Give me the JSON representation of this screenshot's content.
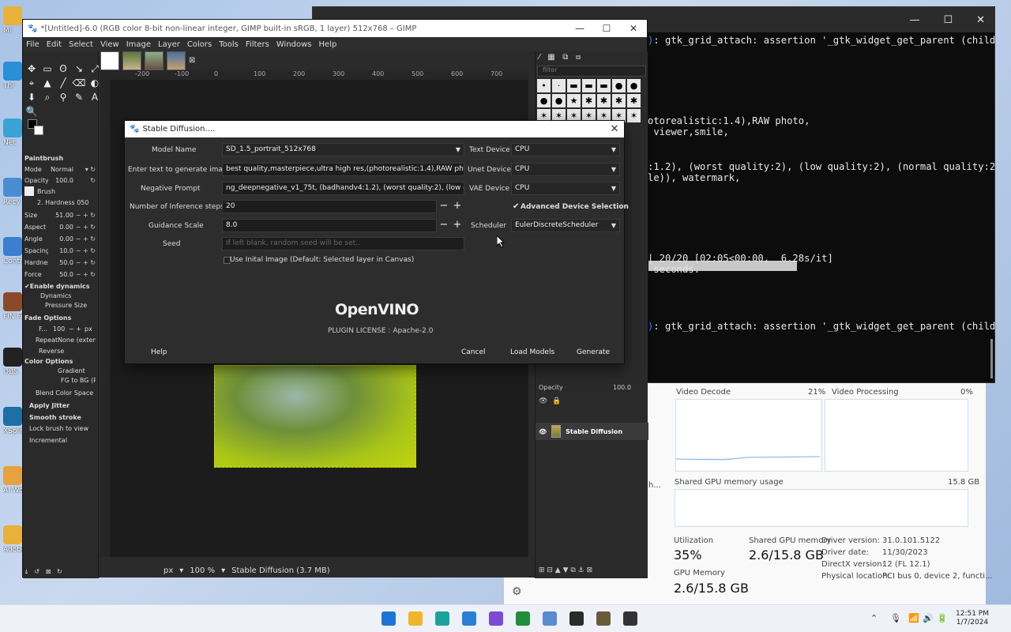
{
  "desktop": {
    "icons": [
      {
        "label": "MI",
        "color": "#e8b13a"
      },
      {
        "label": "Thi",
        "color": "#2a8fd6"
      },
      {
        "label": "Net",
        "color": "#3aa3d6"
      },
      {
        "label": "Recy",
        "color": "#4a8cd4"
      },
      {
        "label": "Contro",
        "color": "#3c7fd0"
      },
      {
        "label": "FIN FANTA",
        "color": "#8a4a2a"
      },
      {
        "label": "OBS",
        "color": "#222222"
      },
      {
        "label": "XSplit",
        "color": "#1d6fa5"
      },
      {
        "label": "AI Wo Instru",
        "color": "#e6a23c"
      },
      {
        "label": "Adobe - AI Ph",
        "color": "#e8b13a"
      }
    ]
  },
  "terminal": {
    "lines": [
      {
        "text": "): gtk_grid_attach: assertion '_gtk_widget_get_parent (child",
        "blue_prefix": true
      },
      {
        "text": "otorealistic:1.4),RAW photo,",
        "blue_prefix": false
      },
      {
        "text": " viewer,smile,",
        "blue_prefix": false
      },
      {
        "text": ":1.2), (worst quality:2), (low quality:2), (normal quality:2",
        "blue_prefix": false
      },
      {
        "text": "le)), watermark,",
        "blue_prefix": false
      },
      {
        "text": "| 20/20 [02:05<00:00,  6.28s/it]",
        "blue_prefix": false
      },
      {
        "text": " seconds.",
        "blue_prefix": false
      },
      {
        "text": "): gtk_grid_attach: assertion '_gtk_widget_get_parent (child",
        "blue_prefix": true
      }
    ],
    "progress_fraction": 1.0,
    "controls": [
      "—",
      "☐",
      "✕"
    ]
  },
  "taskmgr": {
    "video_decode_label": "Video Decode",
    "video_decode_value": "21%",
    "video_processing_label": "Video Processing",
    "video_processing_value": "0%",
    "shared_gpu_label": "Shared GPU memory usage",
    "shared_gpu_total": "15.8 GB",
    "utilization_label": "Utilization",
    "utilization_value": "35%",
    "shared_gpu_memory_label": "Shared GPU memory",
    "shared_gpu_memory_value": "2.6/15.8 GB",
    "gpu_memory_label": "GPU Memory",
    "gpu_memory_value": "2.6/15.8 GB",
    "driver_version_label": "Driver version:",
    "driver_version_value": "31.0.101.5122",
    "driver_date_label": "Driver date:",
    "driver_date_value": "11/30/2023",
    "directx_label": "DirectX version:",
    "directx_value": "12 (FL 12.1)",
    "physical_location_label": "Physical location:",
    "physical_location_value": "PCI bus 0, device 2, functi...",
    "side_text": "h..."
  },
  "gimp": {
    "title": "*[Untitled]-6.0 (RGB color 8-bit non-linear integer, GIMP built-in sRGB, 1 layer) 512x768 – GIMP",
    "menu": [
      "File",
      "Edit",
      "Select",
      "View",
      "Image",
      "Layer",
      "Colors",
      "Tools",
      "Filters",
      "Windows",
      "Help"
    ],
    "ruler_marks": [
      "-200",
      "-100",
      "0",
      "100",
      "200",
      "300",
      "400",
      "500",
      "600",
      "700"
    ],
    "tool_icons": [
      "✥",
      "▭",
      "ʘ",
      "↘",
      "⤢",
      "⌖",
      "▲",
      "╱",
      "⌫",
      "◐",
      "⬇",
      "⌕",
      "⚲",
      "✎",
      "A",
      "🔍"
    ],
    "tool_options": {
      "header": "Paintbrush",
      "mode_label": "Mode",
      "mode_value": "Normal",
      "opacity_label": "Opacity",
      "opacity_value": "100.0",
      "brush_label": "Brush",
      "brush_value": "2. Hardness 050",
      "size_label": "Size",
      "size_value": "51.00",
      "aspect_label": "Aspect ...",
      "aspect_value": "0.00",
      "angle_label": "Angle",
      "angle_value": "0.00",
      "spacing_label": "Spacing",
      "spacing_value": "10.0",
      "hardness_label": "Hardness",
      "hardness_value": "50.0",
      "force_label": "Force",
      "force_value": "50.0",
      "enable_dynamics": "Enable dynamics",
      "dynamics_label": "Dynamics",
      "dynamics_value": "Pressure Size",
      "fade_options": "Fade Options",
      "fade_label": "F...",
      "fade_value": "100",
      "fade_unit": "px",
      "repeat_label": "Repeat",
      "repeat_value": "None (extend",
      "reverse": "Reverse",
      "color_options": "Color Options",
      "gradient_label": "Gradient",
      "gradient_value": "FG to BG (R",
      "blend_value": "Blend Color Space P...",
      "apply_jitter": "Apply Jitter",
      "smooth_stroke": "Smooth stroke",
      "lock_brush": "Lock brush to view",
      "incremental": "Incremental"
    },
    "status": {
      "unit": "px",
      "zoom": "100 %",
      "info": "Stable Diffusion (3.7 MB)"
    },
    "dock": {
      "filter_placeholder": "filter",
      "brushes": [
        "•",
        "·",
        "▬",
        "▬",
        "▬",
        "●",
        "●",
        "●",
        "●",
        "★",
        "✱",
        "✱",
        "✱",
        "✱",
        "✶",
        "✶",
        "✶",
        "✶",
        "✶",
        "✶",
        "✶"
      ],
      "opacity_label": "Opacity",
      "opacity_value": "100.0",
      "layer_name": "Stable Diffusion"
    }
  },
  "dialog": {
    "title": "Stable Diffusion....",
    "model_name_label": "Model Name",
    "model_name_value": "SD_1.5_portrait_512x768",
    "prompt_label": "Enter text to generate image",
    "prompt_value": "best quality,masterpiece,ultra high res,(photorealistic:1.4),RAW photo, ←a be",
    "negative_label": "Negative Prompt",
    "negative_value": "ng_deepnegative_v1_75t, (badhandv4:1.2), (worst quality:2), (low quality:2), (",
    "steps_label": "Number of Inference steps",
    "steps_value": "20",
    "guidance_label": "Guidance Scale",
    "guidance_value": "8.0",
    "seed_label": "Seed",
    "seed_placeholder": "If left blank, random seed will be set..",
    "init_image_label": "Use Inital Image (Default: Selected layer in Canvas)",
    "text_device_label": "Text Device",
    "text_device_value": "CPU",
    "unet_device_label": "Unet Device",
    "unet_device_value": "CPU",
    "vae_device_label": "VAE Device",
    "vae_device_value": "CPU",
    "advanced_label": "Advanced Device Selection",
    "scheduler_label": "Scheduler",
    "scheduler_value": "EulerDiscreteScheduler",
    "logo_text": "OpenVINO",
    "license_text": "PLUGIN LICENSE : Apache-2.0",
    "help_label": "Help",
    "cancel_label": "Cancel",
    "load_models_label": "Load Models",
    "generate_label": "Generate"
  },
  "taskbar": {
    "apps": [
      {
        "name": "start",
        "color": "#1e74d6"
      },
      {
        "name": "explorer",
        "color": "#f0b52a"
      },
      {
        "name": "edge",
        "color": "#1aa39a"
      },
      {
        "name": "store",
        "color": "#2a7fd6"
      },
      {
        "name": "app-purple",
        "color": "#7b4ad6"
      },
      {
        "name": "xbox",
        "color": "#1f8f3a"
      },
      {
        "name": "monitor",
        "color": "#5a8ad0"
      },
      {
        "name": "terminal",
        "color": "#2b2b2b"
      },
      {
        "name": "gimp",
        "color": "#6a5a3a"
      },
      {
        "name": "obs",
        "color": "#333333"
      }
    ],
    "time": "12:51 PM",
    "date": "1/7/2024"
  }
}
